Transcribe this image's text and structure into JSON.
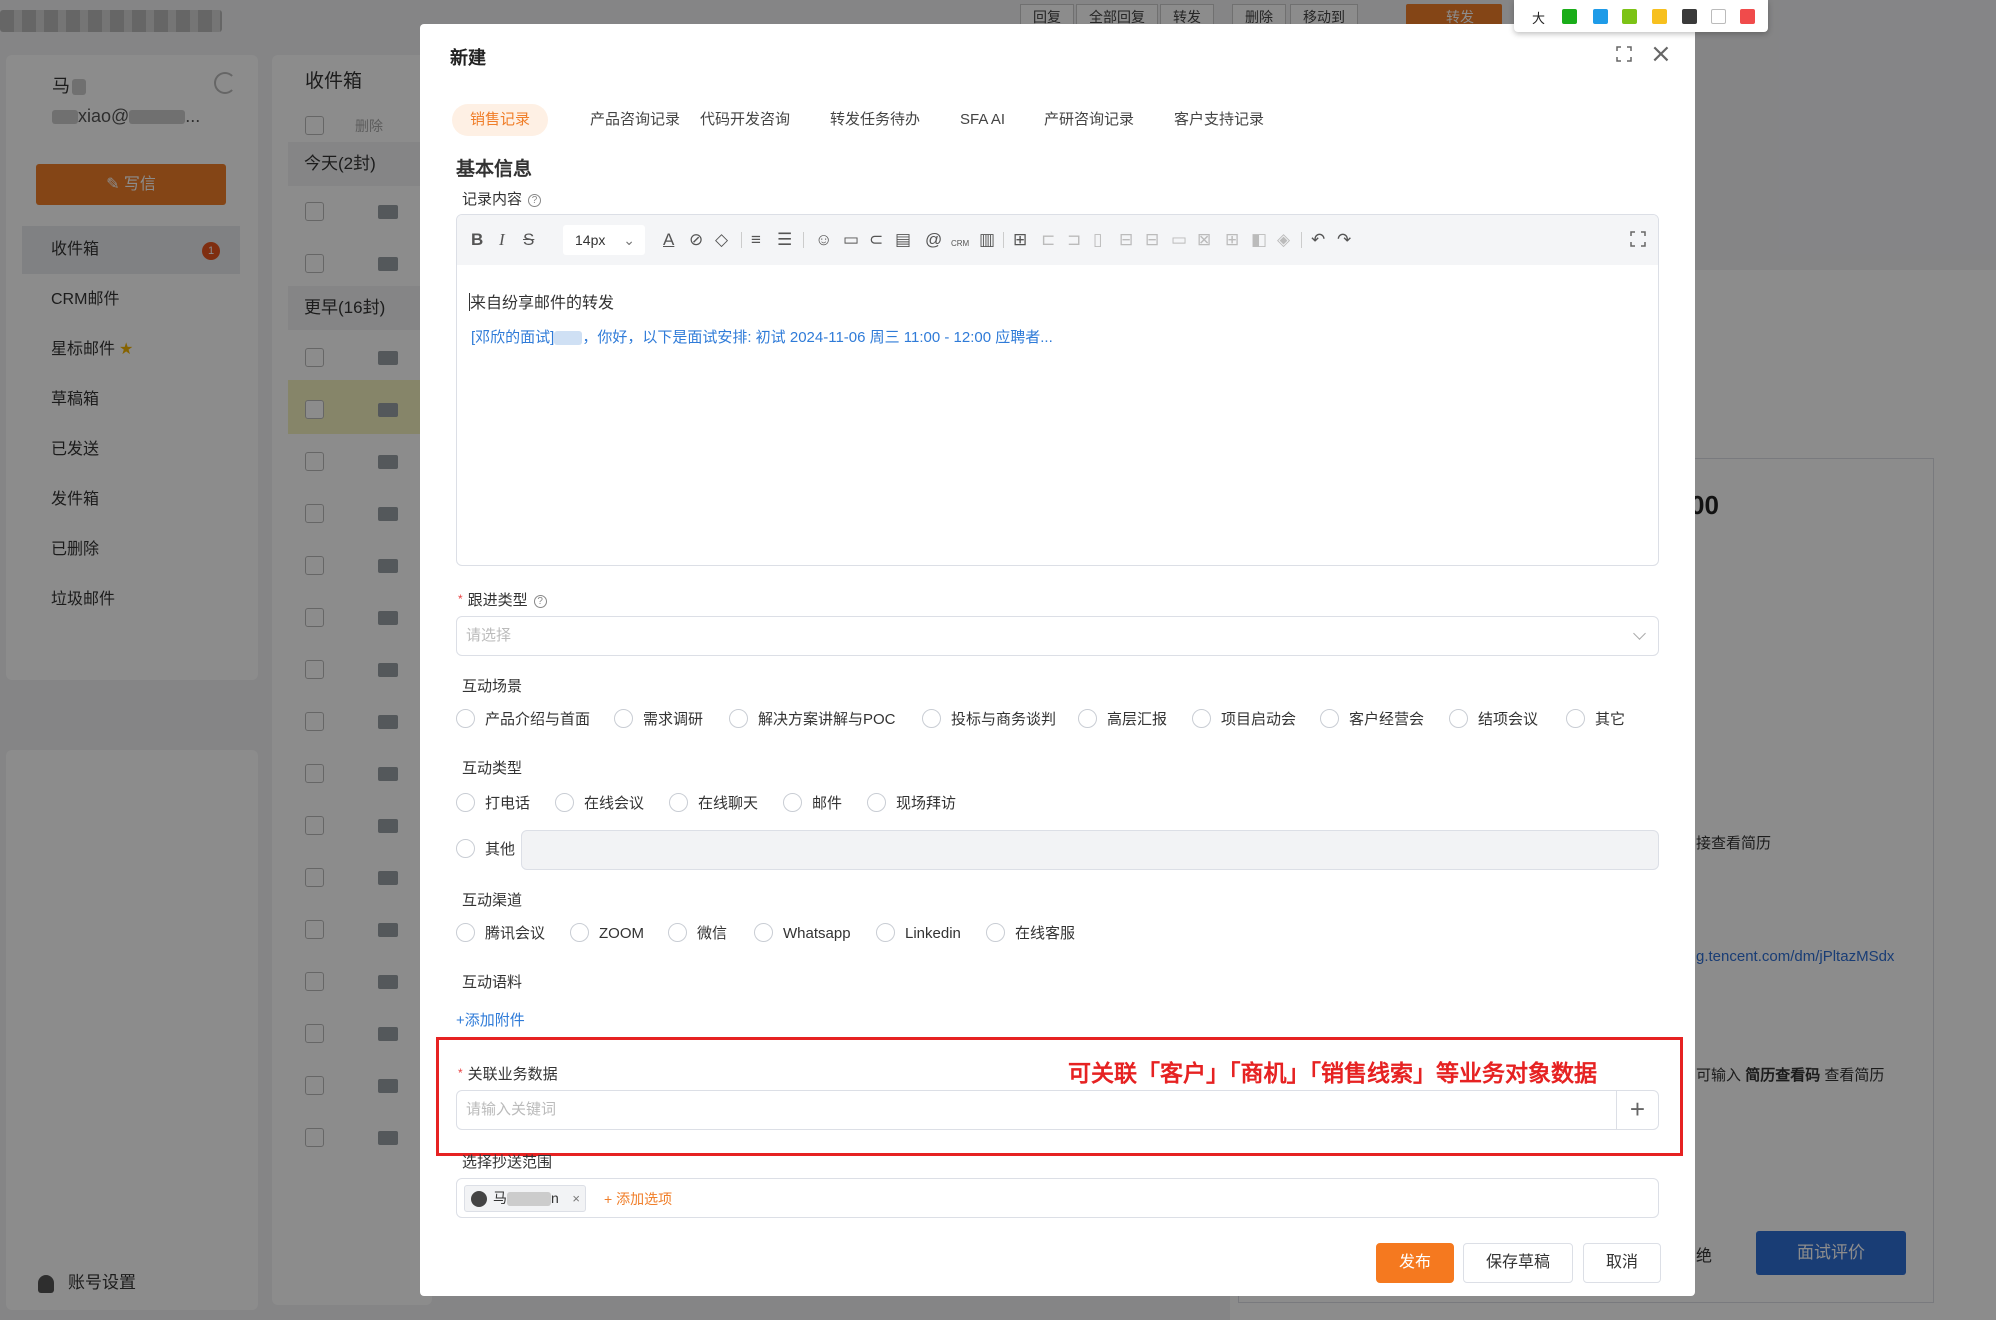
{
  "background": {
    "user_name": "马",
    "user_email": "xiao@",
    "user_email_suffix": "...",
    "write_label": "写信",
    "nav": [
      {
        "label": "收件箱",
        "badge": "1"
      },
      {
        "label": "CRM邮件"
      },
      {
        "label": "星标邮件"
      },
      {
        "label": "草稿箱"
      },
      {
        "label": "已发送"
      },
      {
        "label": "发件箱"
      },
      {
        "label": "已删除"
      },
      {
        "label": "垃圾邮件"
      }
    ],
    "account_settings": "账号设置",
    "inbox_title": "收件箱",
    "delete_label": "删除",
    "group_today": "今天(2封)",
    "group_earlier": "更早(16封)",
    "toolbar": [
      "回复",
      "全部回复",
      "转发",
      "删除",
      "移动到"
    ],
    "toolbar_orange": "转发",
    "right_big": "00",
    "right_text1": "接查看简历",
    "right_link": "g.tencent.com/dm/jPltazMSdx",
    "right_text2_plain": "可输入",
    "right_text2_bold": "简历查看码",
    "right_text2_end": "查看简历",
    "right_reject": "绝",
    "right_button": "面试评价"
  },
  "palette": {
    "label": "大",
    "colors": [
      "#1aad19",
      "#1e9be8",
      "#7cc316",
      "#f7c01e",
      "#3a3a3a",
      "#ffffff",
      "#f04b4b"
    ]
  },
  "modal": {
    "title": "新建",
    "tabs": [
      "销售记录",
      "产品咨询记录",
      "代码开发咨询",
      "转发任务待办",
      "SFA AI",
      "产研咨询记录",
      "客户支持记录"
    ],
    "section_title": "基本信息",
    "record_label": "记录内容",
    "font_size": "14px",
    "editor_line1": "来自纷享邮件的转发",
    "editor_line2_a": "[邓欣的面试]",
    "editor_line2_b": "，你好，以下是面试安排:  初试 2024-11-06 周三 11:00 - 12:00 应聘者...",
    "follow_type_label": "跟进类型",
    "follow_type_placeholder": "请选择",
    "scene_label": "互动场景",
    "scenes": [
      "产品介绍与首面",
      "需求调研",
      "解决方案讲解与POC",
      "投标与商务谈判",
      "高层汇报",
      "项目启动会",
      "客户经营会",
      "结项会议",
      "其它"
    ],
    "interaction_type_label": "互动类型",
    "interaction_types": [
      "打电话",
      "在线会议",
      "在线聊天",
      "邮件",
      "现场拜访"
    ],
    "other_label": "其他",
    "channel_label": "互动渠道",
    "channels": [
      "腾讯会议",
      "ZOOM",
      "微信",
      "Whatsapp",
      "Linkedin",
      "在线客服"
    ],
    "material_label": "互动语料",
    "add_attachment": "+添加附件",
    "related_label": "关联业务数据",
    "related_placeholder": "请输入关键词",
    "annotation": "可关联「客户」「商机」「销售线索」等业务对象数据",
    "cc_label": "选择抄送范围",
    "cc_chip_a": "马",
    "cc_chip_b": "n",
    "add_option": "+ 添加选项",
    "publish": "发布",
    "save_draft": "保存草稿",
    "cancel": "取消"
  }
}
